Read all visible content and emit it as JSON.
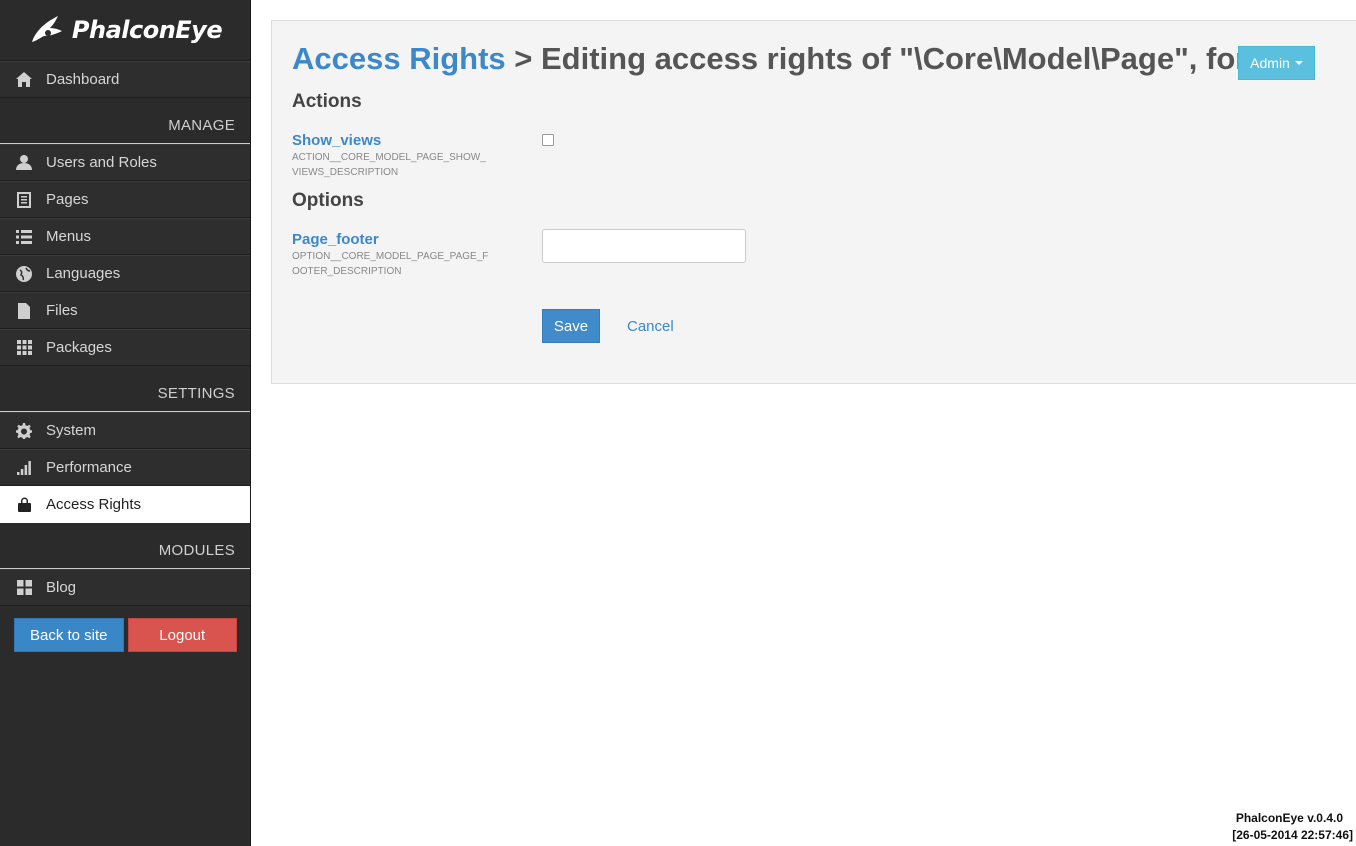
{
  "app": {
    "logo_text": "PhalconEye"
  },
  "sidebar": {
    "dashboard": {
      "label": "Dashboard",
      "icon": "home-icon"
    },
    "manage_title": "MANAGE",
    "manage": [
      {
        "label": "Users and Roles",
        "icon": "user-icon"
      },
      {
        "label": "Pages",
        "icon": "page-icon"
      },
      {
        "label": "Menus",
        "icon": "list-icon"
      },
      {
        "label": "Languages",
        "icon": "globe-icon"
      },
      {
        "label": "Files",
        "icon": "file-icon"
      },
      {
        "label": "Packages",
        "icon": "grid-icon"
      }
    ],
    "settings_title": "SETTINGS",
    "settings": [
      {
        "label": "System",
        "icon": "gear-icon"
      },
      {
        "label": "Performance",
        "icon": "signal-icon"
      },
      {
        "label": "Access Rights",
        "icon": "lock-icon",
        "active": true
      }
    ],
    "modules_title": "MODULES",
    "modules": [
      {
        "label": "Blog",
        "icon": "dashboard-tiles-icon"
      }
    ],
    "back_label": "Back to site",
    "logout_label": "Logout"
  },
  "main": {
    "title_crumb": "Access Rights",
    "title_rest": " > Editing access rights of \"\\Core\\Model\\Page\", for:",
    "role_button": "Admin",
    "actions_title": "Actions",
    "action": {
      "label": "Show_views",
      "description": "ACTION__CORE_MODEL_PAGE_SHOW_VIEWS_DESCRIPTION",
      "checked": false
    },
    "options_title": "Options",
    "option": {
      "label": "Page_footer",
      "description": "OPTION__CORE_MODEL_PAGE_PAGE_FOOTER_DESCRIPTION",
      "value": ""
    },
    "save_label": "Save",
    "cancel_label": "Cancel"
  },
  "footer": {
    "version": "PhalconEye v.0.4.0",
    "timestamp": "[26-05-2014 22:57:46]"
  },
  "colors": {
    "sidebar_bg": "#2b2b2b",
    "link_blue": "#3c88c9",
    "role_btn": "#5bc0de",
    "save_btn": "#428bca",
    "logout_btn": "#d9534f"
  }
}
